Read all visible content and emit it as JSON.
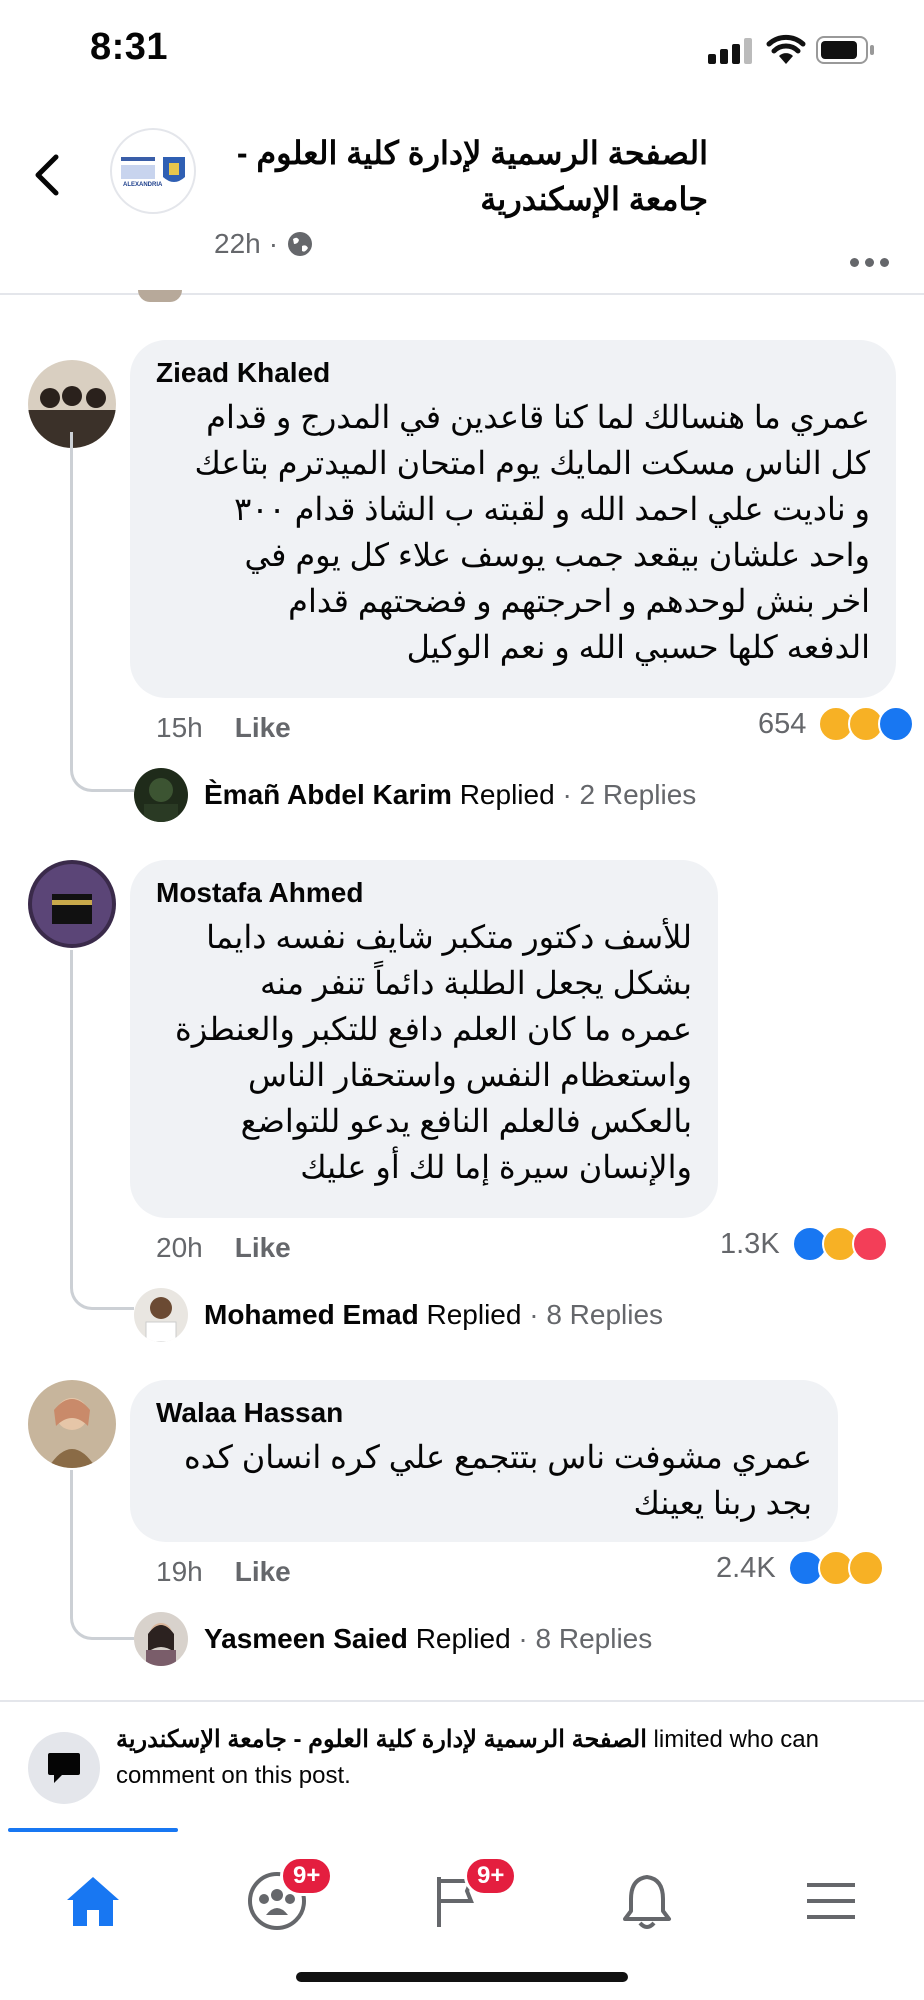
{
  "status_bar": {
    "time": "8:31"
  },
  "header": {
    "page_name": "الصفحة الرسمية لإدارة كلية العلوم - جامعة الإسكندرية",
    "time_ago": "22h",
    "separator": "·",
    "logo_text": "ALEXANDRIA"
  },
  "comments": [
    {
      "author": "Ziead Khaled",
      "text": "عمري ما هنسالك لما كنا قاعدين في المدرج و قدام\nكل الناس مسكت المايك يوم امتحان الميدترم بتاعك\nو ناديت علي احمد الله و لقبته ب الشاذ قدام ٣٠٠\nواحد علشان بيقعد جمب يوسف علاء كل يوم في\nاخر بنش لوحدهم و احرجتهم و فضحتهم قدام\nالدفعه كلها حسبي الله و نعم الوكيل",
      "time": "15h",
      "like_label": "Like",
      "reaction_count": "654",
      "reactions": [
        "sad",
        "wow",
        "like"
      ],
      "reply": {
        "name": "Èmañ Abdel Karim",
        "action": "Replied",
        "count": "· 2 Replies"
      }
    },
    {
      "author": "Mostafa Ahmed",
      "text": "للأسف دكتور متكبر شايف نفسه دايما\nبشكل يجعل الطلبة دائماً تنفر منه\nعمره ما كان العلم دافع للتكبر والعنطزة\nواستعظام النفس واستحقار الناس\nبالعكس فالعلم النافع يدعو للتواضع\nوالإنسان سيرة إما لك أو عليك",
      "time": "20h",
      "like_label": "Like",
      "reaction_count": "1.3K",
      "reactions": [
        "like",
        "sad",
        "love"
      ],
      "reply": {
        "name": "Mohamed Emad",
        "action": "Replied",
        "count": "· 8 Replies"
      }
    },
    {
      "author": "Walaa Hassan",
      "text": "عمري مشوفت ناس بتتجمع علي كره انسان كده\nبجد ربنا يعينك",
      "time": "19h",
      "like_label": "Like",
      "reaction_count": "2.4K",
      "reactions": [
        "like",
        "haha",
        "sad"
      ],
      "reply": {
        "name": "Yasmeen Saied",
        "action": "Replied",
        "count": "· 8 Replies"
      }
    }
  ],
  "limited_notice": {
    "page_name": "الصفحة الرسمية لإدارة كلية العلوم - جامعة الإسكندرية",
    "text_1": " limited who can",
    "text_2": "comment on this post."
  },
  "tabs": {
    "groups_badge": "9+",
    "feeds_badge": "9+"
  },
  "colors": {
    "accent": "#1877f2",
    "badge": "#e41e3f",
    "bubble": "#f0f2f5",
    "secondary_text": "#65676b"
  }
}
